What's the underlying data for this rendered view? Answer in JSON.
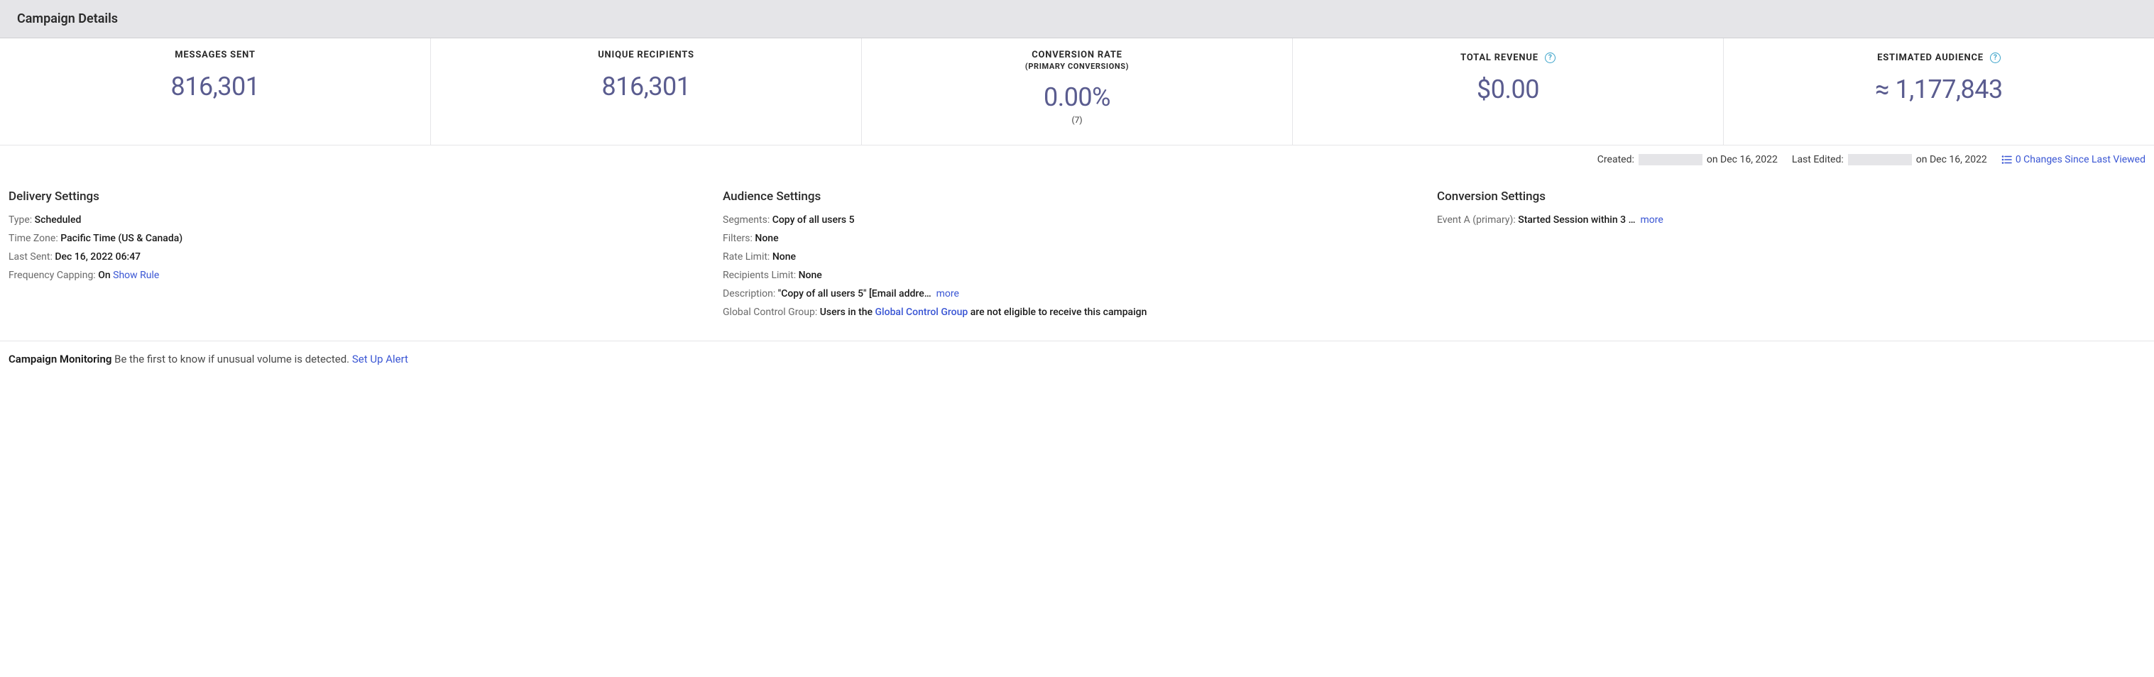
{
  "header": {
    "title": "Campaign Details"
  },
  "stats": [
    {
      "label": "MESSAGES SENT",
      "sublabel": "",
      "value": "816,301",
      "subvalue": "",
      "info": false
    },
    {
      "label": "UNIQUE RECIPIENTS",
      "sublabel": "",
      "value": "816,301",
      "subvalue": "",
      "info": false
    },
    {
      "label": "CONVERSION RATE",
      "sublabel": "(PRIMARY CONVERSIONS)",
      "value": "0.00%",
      "subvalue": "(7)",
      "info": false
    },
    {
      "label": "TOTAL REVENUE",
      "sublabel": "",
      "value": "$0.00",
      "subvalue": "",
      "info": true
    },
    {
      "label": "ESTIMATED AUDIENCE",
      "sublabel": "",
      "value": "≈ 1,177,843",
      "subvalue": "",
      "info": true
    }
  ],
  "meta": {
    "created_label": "Created:",
    "created_date": "on Dec 16, 2022",
    "edited_label": "Last Edited:",
    "edited_date": "on Dec 16, 2022",
    "changes_link": "0 Changes Since Last Viewed"
  },
  "settings": {
    "delivery": {
      "title": "Delivery Settings",
      "type_label": "Type:",
      "type_value": "Scheduled",
      "tz_label": "Time Zone:",
      "tz_value": "Pacific Time (US & Canada)",
      "last_sent_label": "Last Sent:",
      "last_sent_value": "Dec 16, 2022 06:47",
      "freq_label": "Frequency Capping:",
      "freq_value": "On",
      "show_rule": "Show Rule"
    },
    "audience": {
      "title": "Audience Settings",
      "segments_label": "Segments:",
      "segments_value": "Copy of all users 5",
      "filters_label": "Filters:",
      "filters_value": "None",
      "rate_label": "Rate Limit:",
      "rate_value": "None",
      "recip_label": "Recipients Limit:",
      "recip_value": "None",
      "desc_label": "Description:",
      "desc_value": "\"Copy of all users 5\" [Email addre…",
      "desc_more": "more",
      "gcg_label": "Global Control Group:",
      "gcg_pre": "Users in the ",
      "gcg_link": "Global Control Group",
      "gcg_post": " are not eligible to receive this campaign"
    },
    "conversion": {
      "title": "Conversion Settings",
      "event_label": "Event A (primary):",
      "event_value": "Started Session within 3 …",
      "event_more": "more"
    }
  },
  "monitoring": {
    "title": "Campaign Monitoring",
    "text": "Be the first to know if unusual volume is detected.",
    "link": "Set Up Alert"
  }
}
